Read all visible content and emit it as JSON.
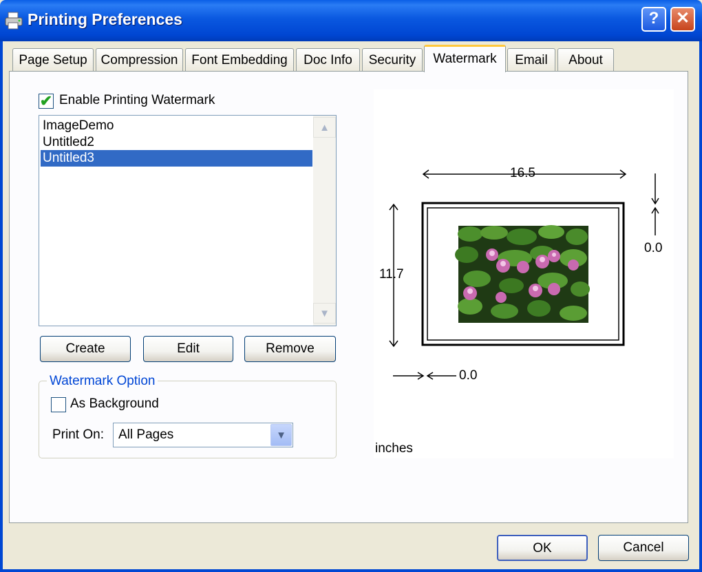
{
  "window": {
    "title": "Printing Preferences",
    "help_label": "?",
    "close_label": "✕"
  },
  "tabs": [
    {
      "label": "Page Setup"
    },
    {
      "label": "Compression"
    },
    {
      "label": "Font Embedding"
    },
    {
      "label": "Doc Info"
    },
    {
      "label": "Security"
    },
    {
      "label": "Watermark"
    },
    {
      "label": "Email"
    },
    {
      "label": "About"
    }
  ],
  "active_tab": "Watermark",
  "watermark": {
    "enable_label": "Enable Printing Watermark",
    "enable_checked": true,
    "list_items": [
      "ImageDemo",
      "Untitled2",
      "Untitled3"
    ],
    "selected_item": "Untitled3",
    "create_label": "Create",
    "edit_label": "Edit",
    "remove_label": "Remove",
    "option_group_label": "Watermark Option",
    "as_background_label": "As Background",
    "as_background_checked": false,
    "print_on_label": "Print On:",
    "print_on_value": "All Pages"
  },
  "preview": {
    "width_value": "16.5",
    "height_value": "11.7",
    "top_offset": "0.0",
    "left_offset": "0.0",
    "units": "inches"
  },
  "footer": {
    "ok_label": "OK",
    "cancel_label": "Cancel"
  },
  "colors": {
    "titlebar": "#0a58e0",
    "selection": "#316ac5",
    "group_label": "#0046d5",
    "tab_highlight": "#ffc83c"
  }
}
